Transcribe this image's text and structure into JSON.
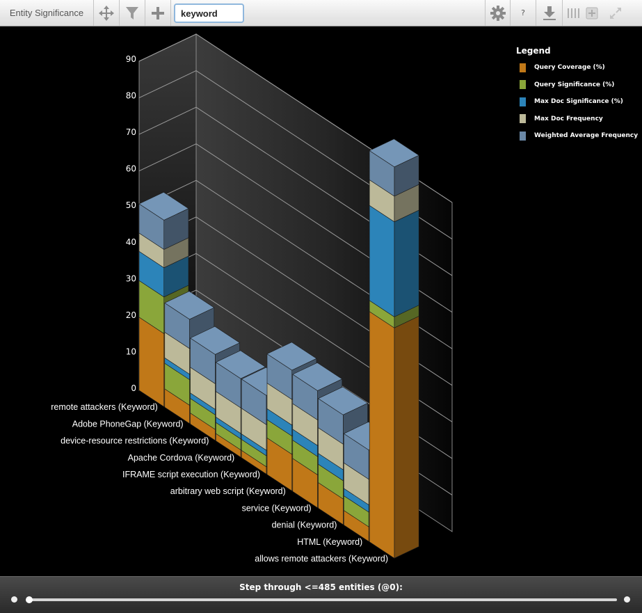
{
  "toolbar": {
    "title": "Entity Significance",
    "search_value": "keyword",
    "help_label": "?",
    "icons": [
      "move-icon",
      "filter-icon",
      "plus-icon",
      "gear-icon",
      "help-icon",
      "download-icon",
      "columns-icon",
      "zoom-in-icon",
      "expand-icon"
    ]
  },
  "legend": {
    "title": "Legend"
  },
  "chart_data": {
    "type": "bar",
    "stacked": true,
    "three_d": true,
    "ylim": [
      0,
      90
    ],
    "yticks": [
      "0",
      "10",
      "20",
      "30",
      "40",
      "50",
      "60",
      "70",
      "80",
      "90"
    ],
    "categories": [
      "remote attackers (Keyword)",
      "Adobe PhoneGap (Keyword)",
      "device-resource restrictions (Keyword)",
      "Apache Cordova (Keyword)",
      "IFRAME script execution (Keyword)",
      "arbitrary web script (Keyword)",
      "service (Keyword)",
      "denial (Keyword)",
      "HTML (Keyword)",
      "allows remote attackers (Keyword)"
    ],
    "series": [
      {
        "name": "Query Coverage (%)",
        "color": "#c07818",
        "values": [
          20,
          5,
          3,
          2,
          2,
          10,
          9,
          7,
          4,
          63
        ]
      },
      {
        "name": "Query Significance (%)",
        "color": "#8aa63a",
        "values": [
          10,
          7,
          4,
          3,
          3,
          5,
          5,
          5,
          4,
          3
        ]
      },
      {
        "name": "Max Doc Significance (%)",
        "color": "#2c84b9",
        "values": [
          8,
          1.5,
          1.5,
          1.5,
          1.5,
          3,
          3,
          3,
          2,
          26
        ]
      },
      {
        "name": "Max Doc Frequency",
        "color": "#bcb999",
        "values": [
          5,
          7,
          7,
          7,
          7,
          7,
          7,
          7,
          7,
          7
        ]
      },
      {
        "name": "Weighted Average Frequency",
        "color": "#6a88a6",
        "values": [
          8,
          8,
          8,
          8,
          8,
          8,
          8,
          8,
          8,
          8
        ]
      }
    ],
    "grid": true,
    "legend_position": "top-right"
  },
  "footer": {
    "step_label": "Step through <=485 entities (@0):"
  }
}
